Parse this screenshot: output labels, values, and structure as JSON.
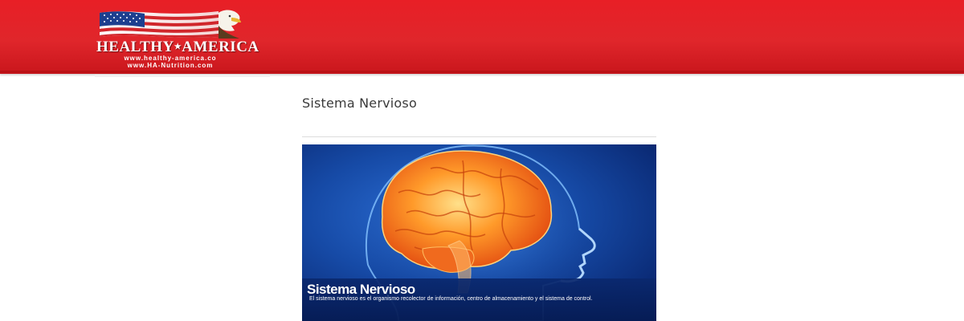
{
  "header": {
    "logo": {
      "brand_left": "HEALTHY",
      "brand_right": "AMERICA",
      "url_primary": "www.healthy-america.co",
      "url_secondary": "www.HA-Nutrition.com"
    },
    "colors": {
      "header_red": "#e0262b",
      "flag_blue": "#1d3f8f",
      "flag_red": "#d0262b"
    }
  },
  "main": {
    "title": "Sistema Nervioso",
    "hero": {
      "caption_title": "Sistema Nervioso",
      "caption_text": "El sistema nervioso es el organismo recolector de información, centro de almacenamiento y el sistema de control.",
      "colors": {
        "background": "#164aa6",
        "brain": "#ff7a1a"
      }
    }
  }
}
